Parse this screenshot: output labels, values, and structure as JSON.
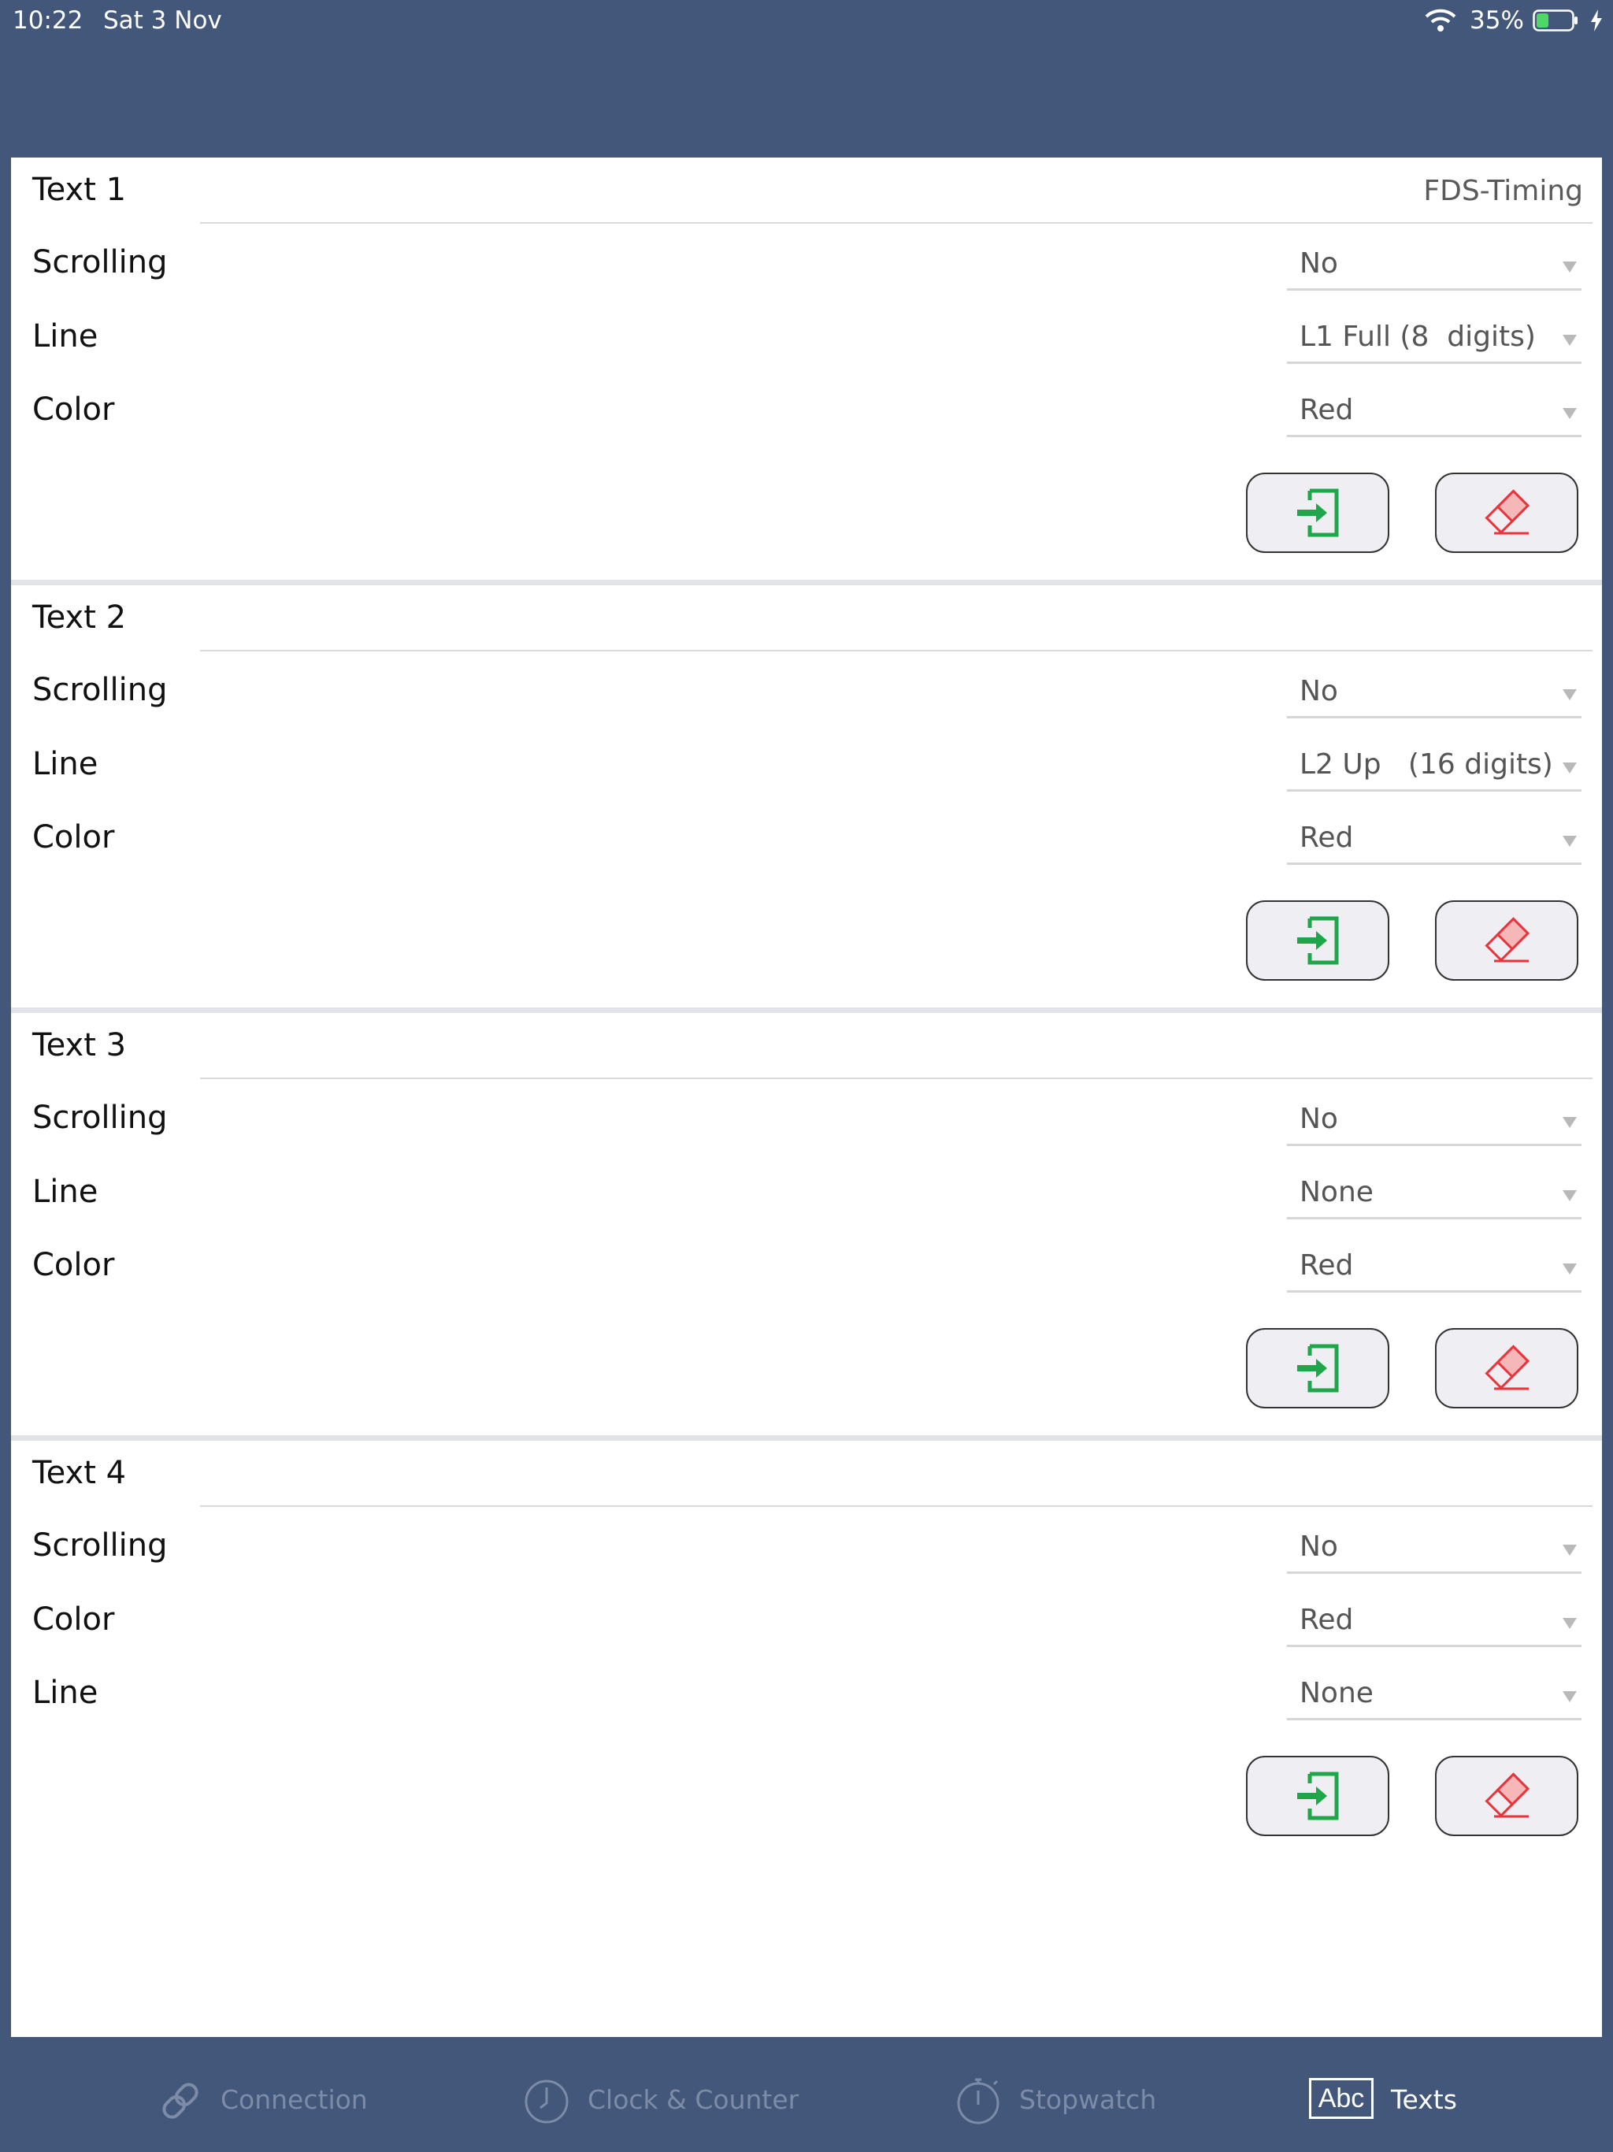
{
  "status_bar": {
    "time": "10:22",
    "date": "Sat 3 Nov",
    "battery_percent": "35%",
    "battery_level": 0.35
  },
  "sections": [
    {
      "title": "Text 1",
      "title_value": "FDS-Timing",
      "rows": [
        {
          "label": "Scrolling",
          "value": "No"
        },
        {
          "label": "Line",
          "value": "L1 Full (8  digits)"
        },
        {
          "label": "Color",
          "value": "Red"
        }
      ]
    },
    {
      "title": "Text 2",
      "title_value": "",
      "rows": [
        {
          "label": "Scrolling",
          "value": "No"
        },
        {
          "label": "Line",
          "value": "L2 Up   (16 digits)"
        },
        {
          "label": "Color",
          "value": "Red"
        }
      ]
    },
    {
      "title": "Text 3",
      "title_value": "",
      "rows": [
        {
          "label": "Scrolling",
          "value": "No"
        },
        {
          "label": "Line",
          "value": "None"
        },
        {
          "label": "Color",
          "value": "Red"
        }
      ]
    },
    {
      "title": "Text 4",
      "title_value": "",
      "rows": [
        {
          "label": "Scrolling",
          "value": "No"
        },
        {
          "label": "Color",
          "value": "Red"
        },
        {
          "label": "Line",
          "value": "None"
        }
      ]
    }
  ],
  "buttons": {
    "send_icon": "send-arrow-icon",
    "erase_icon": "eraser-icon"
  },
  "tabs": [
    {
      "label": "Connection",
      "icon": "link-icon",
      "active": false
    },
    {
      "label": "Clock & Counter",
      "icon": "clock-icon",
      "active": false
    },
    {
      "label": "Stopwatch",
      "icon": "stopwatch-icon",
      "active": false
    },
    {
      "label": "Texts",
      "icon": "abc-icon",
      "icon_text": "Abc",
      "active": true
    }
  ],
  "colors": {
    "header_bg": "#42577a",
    "send_green": "#1fa64a",
    "erase_red": "#e8343a",
    "active_tab": "#ffffff",
    "inactive_tab": "#7c8ca8"
  }
}
